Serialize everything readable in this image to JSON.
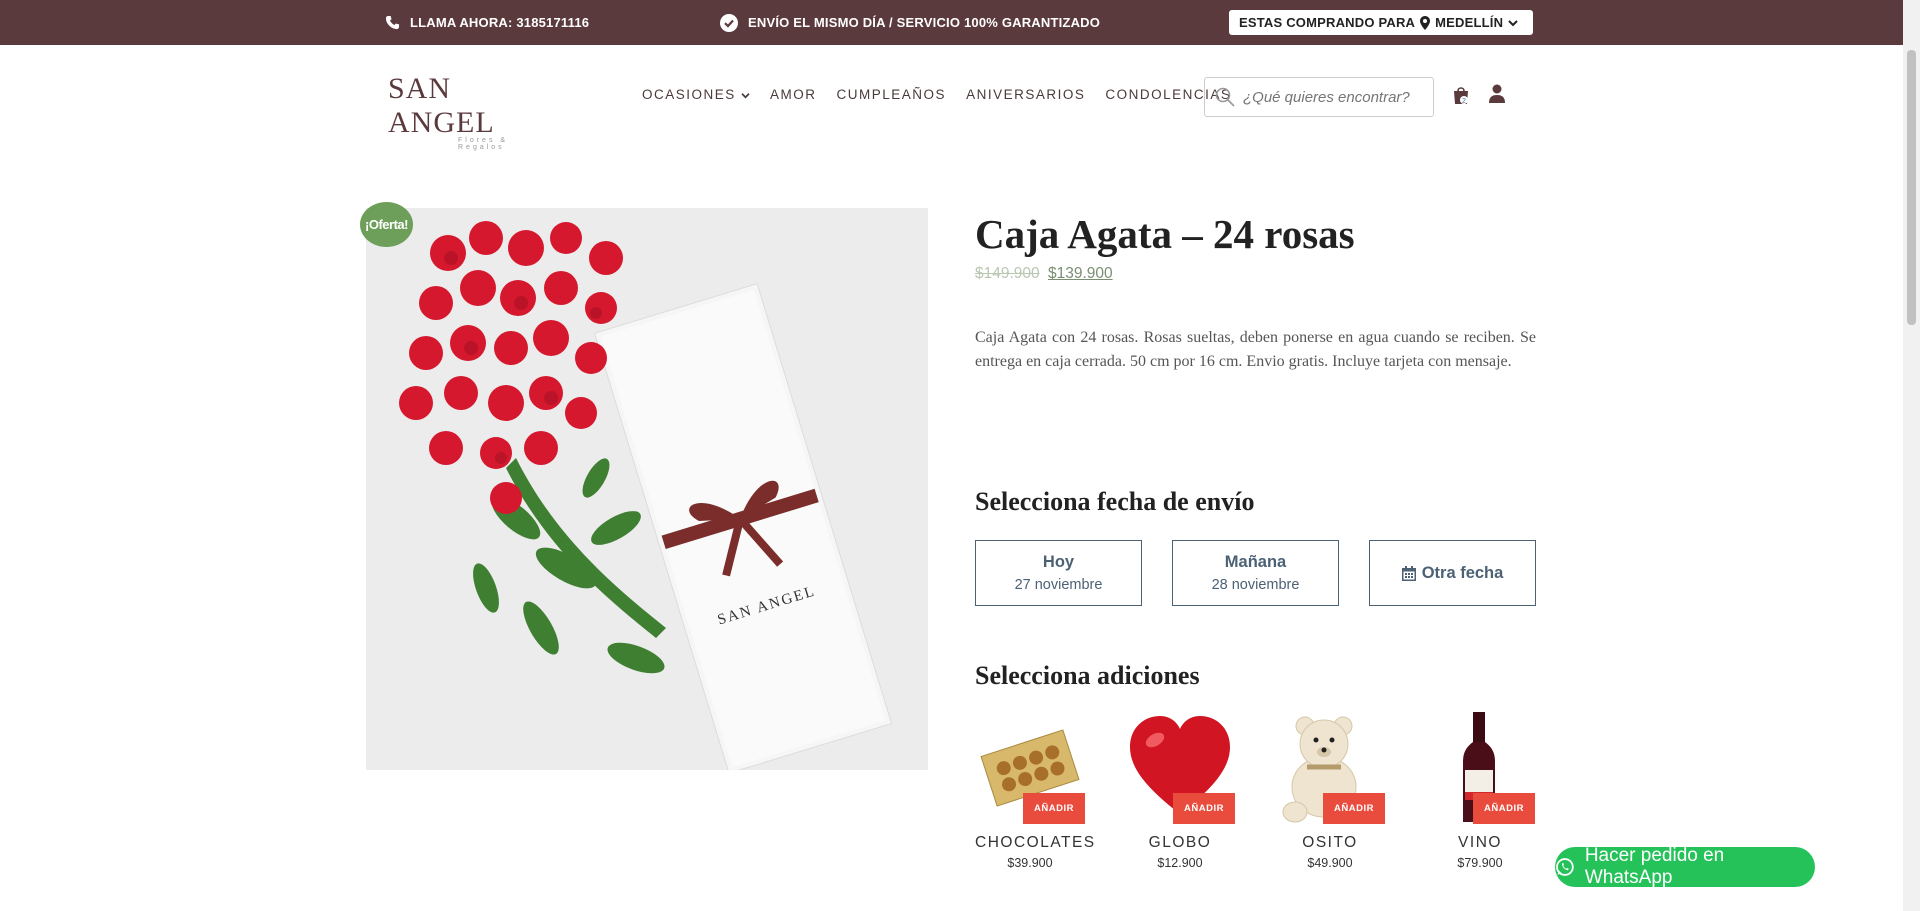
{
  "topbar": {
    "phone": "LLAMA AHORA: 3185171116",
    "shipping": "ENVÍO EL MISMO DÍA / SERVICIO 100% GARANTIZADO",
    "buying_for": "ESTAS COMPRANDO PARA",
    "city": "MEDELLÍN"
  },
  "header": {
    "logo_name": "SAN ANGEL",
    "logo_sub": "Flores & Regalos",
    "nav": [
      "OCASIONES",
      "AMOR",
      "CUMPLEAÑOS",
      "ANIVERSARIOS",
      "CONDOLENCIAS"
    ],
    "search_placeholder": "¿Qué quieres encontrar?",
    "cart_count": "2"
  },
  "product": {
    "badge": "¡Oferta!",
    "title": "Caja Agata – 24 rosas",
    "old_price": "$149.900",
    "new_price": "$139.900",
    "description": "Caja Agata con 24 rosas. Rosas sueltas, deben ponerse en agua cuando se reciben. Se entrega en caja cerrada. 50 cm por 16 cm. Envio gratis. Incluye tarjeta con mensaje.",
    "box_brand": "SAN ANGEL"
  },
  "delivery": {
    "heading": "Selecciona fecha de envío",
    "options": [
      {
        "label": "Hoy",
        "date": "27 noviembre"
      },
      {
        "label": "Mañana",
        "date": "28 noviembre"
      }
    ],
    "other": "Otra fecha"
  },
  "addons": {
    "heading": "Selecciona adiciones",
    "add_label": "AÑADIR",
    "items": [
      {
        "name": "CHOCOLATES",
        "price": "$39.900"
      },
      {
        "name": "GLOBO",
        "price": "$12.900"
      },
      {
        "name": "OSITO",
        "price": "$49.900"
      },
      {
        "name": "VINO",
        "price": "$79.900"
      }
    ]
  },
  "whatsapp": "Hacer pedido en WhatsApp",
  "colors": {
    "topbar": "#5b3a3d",
    "offer_badge": "#6e9f5a",
    "add_button": "#e94b3c",
    "whatsapp": "#25c25a",
    "date_border": "#4d6175"
  }
}
